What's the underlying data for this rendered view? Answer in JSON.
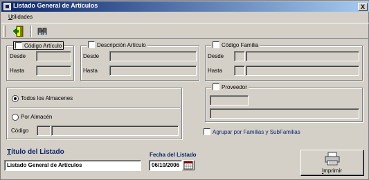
{
  "window": {
    "title": "Listado General de Artículos",
    "close_glyph": "X"
  },
  "menu": {
    "utilidades_first": "U",
    "utilidades_rest": "tilidades"
  },
  "toolbar": {
    "items": [
      "exit-door-icon",
      "binoculars-icon"
    ]
  },
  "codigo_articulo": {
    "label": "Código Artículo",
    "desde": "Desde",
    "hasta": "Hasta"
  },
  "descripcion_articulo": {
    "label": "Descripción Artículo",
    "desde": "Desde",
    "hasta": "Hasta"
  },
  "codigo_familia": {
    "label": "Código Familia",
    "desde": "Desde",
    "hasta": "Hasta"
  },
  "almacenes": {
    "todos_label": "Todos los Almacenes",
    "por_almacen_label": "Por Almacén",
    "codigo_label": "Código",
    "selected": "todos"
  },
  "proveedor": {
    "label": "Proveedor"
  },
  "agrupar": {
    "label": "Agrupar por Familias y SubFamilias"
  },
  "titulo": {
    "label_first": "T",
    "label_rest": "ítulo del Listado",
    "value": "Listado General de Artículos"
  },
  "fecha": {
    "label": "Fecha del Listado",
    "value": "06/10/2006"
  },
  "imprimir": {
    "label_first": "I",
    "label_rest": "mprimir"
  },
  "colors": {
    "title_bar": "#0a246a",
    "face": "#d4d0c8",
    "accent_text": "#0a246a"
  }
}
